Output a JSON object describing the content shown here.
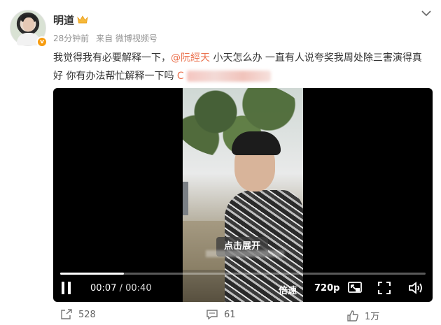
{
  "post": {
    "username": "明道",
    "verified_badge": "v",
    "meta": {
      "time": "28分钟前",
      "source": "来自 微博视频号"
    },
    "text": {
      "part1": "我觉得我有必要解释一下，",
      "mention": "@阮經天",
      "part2": " 小天怎么办 一直有人说夸奖我周处除三害演得真好 你有办法帮忙解释一下吗 ",
      "link_prefix": "C"
    }
  },
  "video": {
    "expand_label": "点击展开",
    "current_time": "00:07",
    "separator": " / ",
    "total_time": "00:40",
    "progress_fraction": 0.175,
    "speed_label": "倍速",
    "quality_label": "720p"
  },
  "actions": {
    "repost_count": "528",
    "comment_count": "61",
    "like_count": "1万"
  },
  "icons": [
    "crown-icon",
    "chevron-down-icon",
    "pause-icon",
    "pip-icon",
    "fullscreen-icon",
    "volume-icon",
    "repost-icon",
    "comment-icon",
    "like-icon"
  ],
  "colors": {
    "mention": "#eb7350",
    "badge": "#f79c0f",
    "meta": "#939393"
  }
}
